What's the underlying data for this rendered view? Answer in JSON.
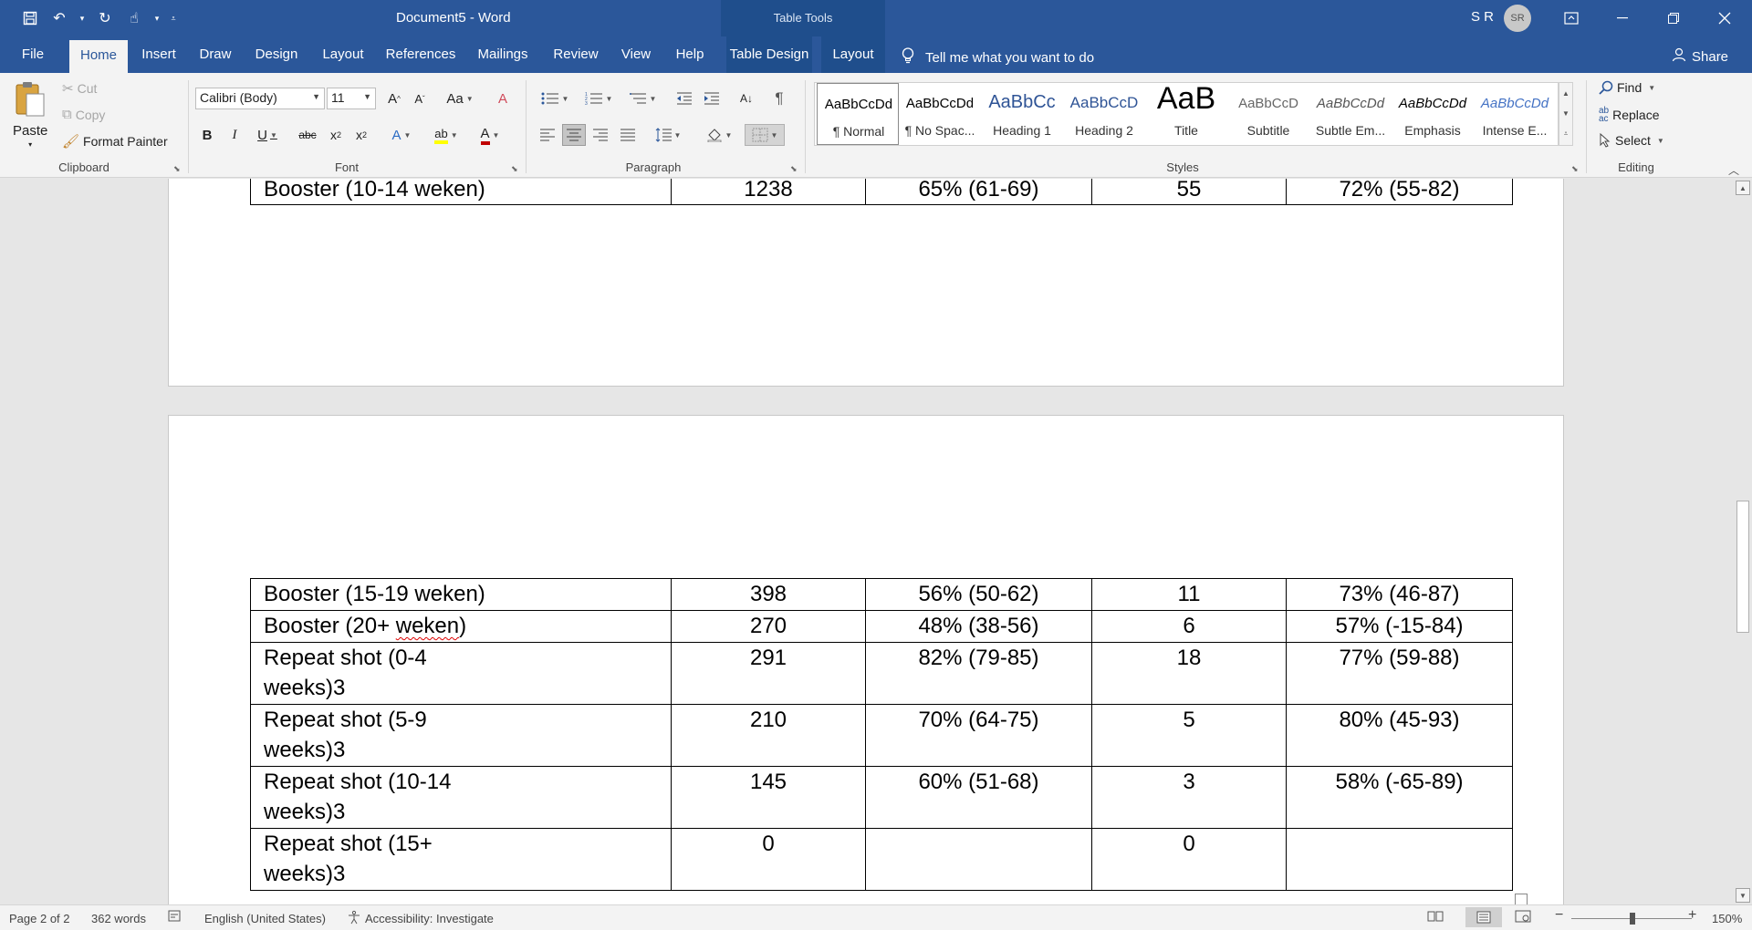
{
  "window": {
    "title": "Document5  -  Word",
    "context_group": "Table Tools",
    "user_initials": "S R",
    "avatar_initials": "SR"
  },
  "ribbon_tabs": [
    "File",
    "Home",
    "Insert",
    "Draw",
    "Design",
    "Layout",
    "References",
    "Mailings",
    "Review",
    "View",
    "Help",
    "Table Design",
    "Layout"
  ],
  "active_tab": "Home",
  "tell_me": "Tell me what you want to do",
  "share": "Share",
  "clipboard": {
    "paste": "Paste",
    "cut": "Cut",
    "copy": "Copy",
    "format_painter": "Format Painter",
    "label": "Clipboard"
  },
  "font": {
    "name": "Calibri (Body)",
    "size": "11",
    "label": "Font"
  },
  "paragraph": {
    "label": "Paragraph"
  },
  "styles": {
    "label": "Styles",
    "items": [
      {
        "sample": "AaBbCcDd",
        "name": "¶ Normal"
      },
      {
        "sample": "AaBbCcDd",
        "name": "¶ No Spac..."
      },
      {
        "sample": "AaBbCc",
        "name": "Heading 1"
      },
      {
        "sample": "AaBbCcD",
        "name": "Heading 2"
      },
      {
        "sample": "AaB",
        "name": "Title"
      },
      {
        "sample": "AaBbCcD",
        "name": "Subtitle"
      },
      {
        "sample": "AaBbCcDd",
        "name": "Subtle Em..."
      },
      {
        "sample": "AaBbCcDd",
        "name": "Emphasis"
      },
      {
        "sample": "AaBbCcDd",
        "name": "Intense E..."
      }
    ]
  },
  "editing": {
    "find": "Find",
    "replace": "Replace",
    "select": "Select",
    "label": "Editing"
  },
  "document": {
    "table_top": [
      {
        "label": "Booster (10-14 weken)",
        "n": "1238",
        "pct": "65% (61-69)",
        "n2": "55",
        "pct2": "72% (55-82)"
      }
    ],
    "table_bottom": [
      {
        "label": "Booster (15-19 weken)",
        "n": "398",
        "pct": "56% (50-62)",
        "n2": "11",
        "pct2": "73% (46-87)"
      },
      {
        "label_a": "Booster (20+ ",
        "label_spell": "weken",
        "label_b": ")",
        "n": "270",
        "pct": "48% (38-56)",
        "n2": "6",
        "pct2": "57% (-15-84)"
      },
      {
        "line1": "Repeat shot (0-4",
        "line2": "weeks)3",
        "n": "291",
        "pct": "82% (79-85)",
        "n2": "18",
        "pct2": "77% (59-88)"
      },
      {
        "line1": "Repeat shot (5-9",
        "line2": "weeks)3",
        "n": "210",
        "pct": "70% (64-75)",
        "n2": "5",
        "pct2": "80% (45-93)"
      },
      {
        "line1": "Repeat shot (10-14",
        "line2": "weeks)3",
        "n": "145",
        "pct": "60% (51-68)",
        "n2": "3",
        "pct2": "58% (-65-89)"
      },
      {
        "line1": "Repeat shot (15+",
        "line2": "weeks)3",
        "n": "0",
        "pct": "",
        "n2": "0",
        "pct2": ""
      }
    ]
  },
  "statusbar": {
    "page": "Page 2 of 2",
    "words": "362 words",
    "language": "English (United States)",
    "accessibility": "Accessibility: Investigate",
    "zoom": "150%"
  },
  "colors": {
    "title_bar": "#2b579a",
    "context_tab": "#1f4e8c",
    "ribbon_bg": "#f3f3f3",
    "workspace": "#e6e6e6"
  }
}
